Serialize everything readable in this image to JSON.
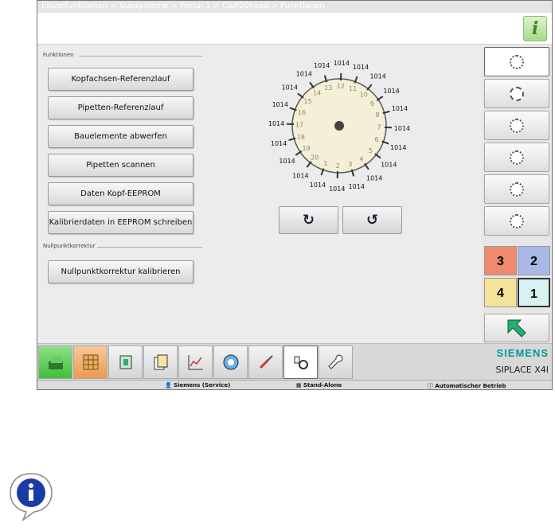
{
  "breadcrumb": "Einzelfunktionen > Subsysteme > Portal 1 > C&P20head > Funktionen",
  "info_label": "i",
  "sections": {
    "funktionen": "Funktionen",
    "nullpunkt": "Nullpunktkorrektur"
  },
  "buttons": {
    "kopfachsen": "Kopfachsen-Referenzlauf",
    "pipetten_ref": "Pipetten-Referenzlauf",
    "bauelemente": "Bauelemente abwerfen",
    "pipetten_scan": "Pipetten scannen",
    "daten_kopf": "Daten Kopf-EEPROM",
    "kalibrier": "Kalibrierdaten in EEPROM schreiben",
    "nullpunkt_kal": "Nullpunktkorrektur kalibrieren"
  },
  "dial": {
    "value_label": "1014",
    "positions": [
      "1",
      "2",
      "3",
      "4",
      "5",
      "6",
      "7",
      "8",
      "9",
      "10",
      "11",
      "12",
      "13",
      "14",
      "15",
      "16",
      "17",
      "18",
      "19",
      "20"
    ]
  },
  "rotate": {
    "ccw": "↻",
    "cw": "↺"
  },
  "side_icons": [
    "dial-view-icon",
    "gear-dial-icon",
    "dial-down-icon",
    "dial-rotate-icon",
    "dial-search-icon",
    "dial-dotted-icon"
  ],
  "quadrants": {
    "q3": "3",
    "q2": "2",
    "q4": "4",
    "q1": "1"
  },
  "quadrant_colors": {
    "q3": "#f08a6e",
    "q2": "#a9b8e4",
    "q4": "#f6e39a",
    "q1": "#d8f2f2"
  },
  "brand": {
    "siemens": "SIEMENS",
    "product": "SIPLACE X4I"
  },
  "status": {
    "user": "Siemens (Service)",
    "mode": "Stand-Alone",
    "operation": "Automatischer Betrieb"
  }
}
